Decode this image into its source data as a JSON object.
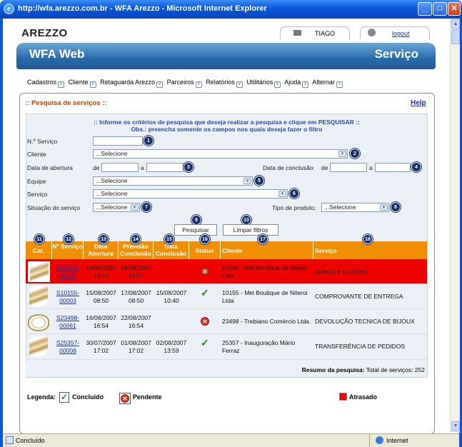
{
  "window": {
    "title": "http://wfa.arezzo.com.br - WFA Arezzo - Microsoft Internet Explorer",
    "minimize_glyph": "_",
    "maximize_glyph": "□",
    "close_glyph": "✕"
  },
  "header": {
    "logo": "AREZZO",
    "user": "TIAGO",
    "logout": "logout",
    "app_name": "WFA Web",
    "section": "Serviço"
  },
  "menu": [
    {
      "label": "Cadastros"
    },
    {
      "label": "Cliente"
    },
    {
      "label": "Retaguarda Arezzo"
    },
    {
      "label": "Parceiros"
    },
    {
      "label": "Relatórios"
    },
    {
      "label": "Utilitários"
    },
    {
      "label": "Ajuda"
    },
    {
      "label": "Alternar"
    }
  ],
  "panel": {
    "title": ":: Pesquisa de serviços ::",
    "help": "Help",
    "instruction1": ":: Informe os critérios de pesquisa que deseja realizar a pesquisa e clique em PESQUISAR ::",
    "instruction2": "Obs.: preencha somente os campos nos quais deseja fazer o filtro"
  },
  "form": {
    "n_servico": {
      "label": "N.º Serviço",
      "value": ""
    },
    "cliente": {
      "label": "Cliente",
      "value": "...Selecione"
    },
    "data_abertura": {
      "label": "Data de abertura",
      "de": "de",
      "a": "a",
      "from": "",
      "to": ""
    },
    "data_conclusao": {
      "label": "Data de conclusão:",
      "de": "de",
      "a": "a",
      "from": "",
      "to": ""
    },
    "equipe": {
      "label": "Equipe",
      "value": "...Selecione"
    },
    "servico": {
      "label": "Serviço",
      "value": "...Selecione"
    },
    "situacao": {
      "label": "Situação do serviço",
      "value": "...Selecione"
    },
    "tipo_produto": {
      "label": "Tipo de produto:",
      "value": "...Selecione"
    },
    "pesquisar": "Pesquisar",
    "limpar": "Limpar filtros"
  },
  "callouts": [
    "1",
    "2",
    "3",
    "4",
    "5",
    "6",
    "7",
    "8",
    "9",
    "10",
    "11",
    "12",
    "13",
    "14",
    "15",
    "16",
    "17",
    "18"
  ],
  "table": {
    "headers": {
      "cat": "Cat.",
      "n_servico": "Nº Serviço",
      "abertura": "Data Abertura",
      "previsao": "Previsão Conclusão",
      "conclusao": "Data Conclusão",
      "status": "Status",
      "cliente": "Cliente",
      "servico": "Serviço"
    },
    "rows": [
      {
        "cat": "sandal-icon",
        "n_servico": "S10155-00002",
        "abertura": "16/08/2007 16:07",
        "previsao": "16/08/2007 16:07",
        "conclusao": "",
        "status": "pendente",
        "cliente": "10155 - Mel Boutique de Niteroi Ltda",
        "servico": "JUROS E CUSTAS",
        "atrasado": true
      },
      {
        "cat": "sandal-icon",
        "n_servico": "S10155-00003",
        "abertura": "15/08/2007 08:50",
        "previsao": "17/08/2007 08:50",
        "conclusao": "15/08/2007 10:40",
        "status": "concluido",
        "cliente": "10155 - Mel Boutique de Niteroi Ltda",
        "servico": "COMPROVANTE DE ENTREGA",
        "atrasado": false
      },
      {
        "cat": "ring-icon",
        "n_servico": "S23498-00061",
        "abertura": "16/08/2007 16:54",
        "previsao": "22/08/2007 16:54",
        "conclusao": "",
        "status": "pendente",
        "cliente": "23498 - Trebiano Comércio Ltda.",
        "servico": "DEVOLUÇÃO TECNICA DE BIJOUX",
        "atrasado": false
      },
      {
        "cat": "sandal-icon",
        "n_servico": "S25357-00008",
        "abertura": "30/07/2007 17:02",
        "previsao": "01/08/2007 17:02",
        "conclusao": "02/08/2007 13:59",
        "status": "concluido",
        "cliente": "25357 - Inauguração Mário Ferraz",
        "servico": "TRANSFERÊNCIA DE PEDIDOS",
        "atrasado": false
      }
    ]
  },
  "resumo": {
    "label": "Resumo da pesquisa:",
    "text": "Total de serviços: 252"
  },
  "legend": {
    "title": "Legenda:",
    "concluido": "Concluído",
    "pendente": "Pendente",
    "atrasado": "Atrasado"
  },
  "statusbar": {
    "left": "Concluído",
    "right": "Internet"
  },
  "colors": {
    "header_orange": "#f09000",
    "atrasado_red": "#ee0000",
    "titlebar_blue": "#0a56d8"
  }
}
